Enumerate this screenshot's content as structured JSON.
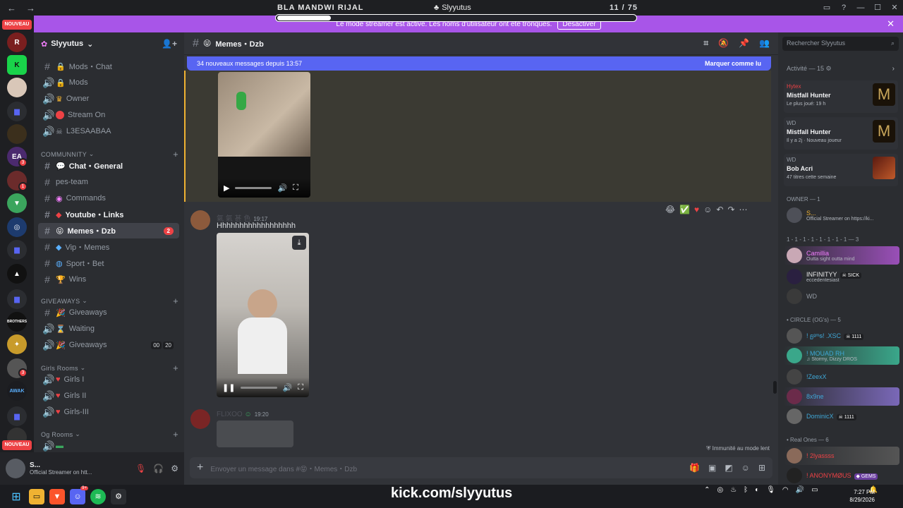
{
  "titlebar": {
    "stream_title": "BLA MANDWI RIJAL",
    "app_title": "Slyyutus",
    "counter": "11 / 75",
    "progress": 0.15
  },
  "banner": {
    "text": "Le mode streamer est activé. Les noms d'utilisateur ont été tronqués.",
    "button": "Désactiver"
  },
  "rail": {
    "new_badge": "NOUVEAU",
    "new_badge_bottom": "NOUVEAU",
    "badges": [
      "3",
      "1",
      "3"
    ]
  },
  "server": {
    "name": "Slyyutus"
  },
  "channels": {
    "top": [
      {
        "label": "Mods・Chat",
        "type": "text"
      },
      {
        "label": "Mods",
        "type": "voice"
      },
      {
        "label": "Owner",
        "type": "voice"
      },
      {
        "label": "Stream On",
        "type": "voice"
      },
      {
        "label": "L3ESAABAA",
        "type": "voice"
      }
    ],
    "community_label": "COMMUNNITY",
    "community": [
      {
        "label": "Chat・General",
        "type": "text",
        "unread": true
      },
      {
        "label": "pes-team",
        "type": "text"
      },
      {
        "label": "Commands",
        "type": "text"
      },
      {
        "label": "Youtube・Links",
        "type": "text",
        "unread": true
      },
      {
        "label": "Memes・Dzb",
        "type": "text",
        "active": true,
        "mentions": "2"
      },
      {
        "label": "Vip・Memes",
        "type": "text"
      },
      {
        "label": "Sport・Bet",
        "type": "text"
      },
      {
        "label": "Wins",
        "type": "text"
      }
    ],
    "giveaways_label": "GIVEAWAYS",
    "giveaways": [
      {
        "label": "Giveaways",
        "type": "text"
      },
      {
        "label": "Waiting",
        "type": "voice"
      },
      {
        "label": "Giveaways",
        "type": "voice",
        "count_a": "00",
        "count_b": "20"
      }
    ],
    "girls_label": "Girls Rooms",
    "girls": [
      {
        "label": "Girls I",
        "type": "voice"
      },
      {
        "label": "Girls II",
        "type": "voice"
      },
      {
        "label": "Girls-III",
        "type": "voice"
      }
    ],
    "og_label": "Og Rooms"
  },
  "user_panel": {
    "name": "S...",
    "status": "Official Streamer on htt..."
  },
  "chat": {
    "channel_title": "Memes・Dzb",
    "new_messages": "34 nouveaux messages depuis 13:57",
    "mark_read": "Marquer comme lu",
    "msg2_author": "氣 氣 甚 色",
    "msg2_time": "19:17",
    "msg2_text": "Hhhhhhhhhhhhhhhhhh",
    "msg3_author": "FLIXOO",
    "msg3_time": "19:20",
    "slow_mode": "Immunité au mode lent",
    "composer_placeholder": "Envoyer un message dans #😝・Memes・Dzb"
  },
  "members": {
    "search_placeholder": "Rechercher Slyyutus",
    "activity_title": "Activité — 15",
    "activities": [
      {
        "user": "Hytex",
        "game": "Mistfall Hunter",
        "meta": "Le plus joué: 19 h"
      },
      {
        "user": "WD",
        "game": "Mistfall Hunter",
        "meta": "Il y a 2j · Nouveau joueur"
      },
      {
        "user": "WD",
        "game": "Bob Acri",
        "meta": "47 titres cette semaine"
      }
    ],
    "owner_title": "OWNER — 1",
    "owner": {
      "name": "S...",
      "status": "Official Streamer on https://ki..."
    },
    "group2_title": "1 - 1 - 1 - 1 - 1 - 1 - 1 - 1 — 3",
    "group2": [
      {
        "name": "Camillia",
        "status": "Outta sight outta mind"
      },
      {
        "name": "INFINITYY",
        "tag": "SICK",
        "status": "eccedentesiast"
      },
      {
        "name": "WD",
        "status": ""
      }
    ],
    "circle_title": "• CIRCLE (OG's) — 5",
    "circle": [
      {
        "name": "! ᵷᶢᵐᵴ! .XSC",
        "tag": "1111",
        "status": ""
      },
      {
        "name": "! MOUAD RH",
        "status": "Stormy, Dizzy DROS"
      },
      {
        "name": "!ZeexX",
        "status": ""
      },
      {
        "name": "8x9ne",
        "status": ""
      },
      {
        "name": "DominicX",
        "tag": "1111",
        "status": ""
      }
    ],
    "real_title": "• Real Ones — 6",
    "real": [
      {
        "name": "! 2lyassss",
        "status": ""
      },
      {
        "name": "! ANONYMØUS",
        "tag": "GEMS",
        "status": ""
      }
    ]
  },
  "taskbar": {
    "kick": "kick.com/slyyutus",
    "time": "7:27 PM",
    "date": "8/29/2026",
    "discord_badge": "9+"
  }
}
